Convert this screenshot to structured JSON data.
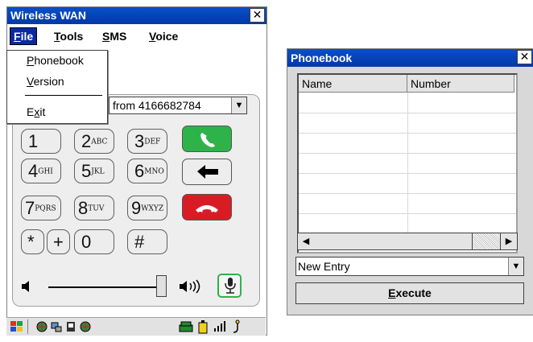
{
  "wireless_window": {
    "title": "Wireless WAN",
    "close_label": "✕",
    "menu": {
      "file_pre": "",
      "file_u": "F",
      "file_post": "ile",
      "tools_u": "T",
      "tools_post": "ools",
      "sms_u": "S",
      "sms_post": "MS",
      "voice_u": "V",
      "voice_post": "oice"
    },
    "file_menu": {
      "phonebook_u": "P",
      "phonebook_post": "honebook",
      "version_u": "V",
      "version_post": "ersion",
      "exit_pre": "E",
      "exit_u": "x",
      "exit_post": "it"
    },
    "caller_dropdown": {
      "value": "from 4166682784"
    },
    "keypad": [
      {
        "main": "1",
        "sub": ""
      },
      {
        "main": "2",
        "sub": "ABC"
      },
      {
        "main": "3",
        "sub": "DEF"
      },
      {
        "main": "4",
        "sub": "GHI"
      },
      {
        "main": "5",
        "sub": "JKL"
      },
      {
        "main": "6",
        "sub": "MNO"
      },
      {
        "main": "7",
        "sub": "PQRS"
      },
      {
        "main": "8",
        "sub": "TUV"
      },
      {
        "main": "9",
        "sub": "WXYZ"
      },
      {
        "main": "*",
        "sub": ""
      },
      {
        "main": "+",
        "sub": ""
      },
      {
        "main": "0",
        "sub": ""
      },
      {
        "main": "#",
        "sub": ""
      }
    ],
    "volume_level": 0.97,
    "colors": {
      "call": "#2db34a",
      "end": "#d91c24",
      "title": "#0a4fc8",
      "menu_active": "#0a2aa0"
    }
  },
  "phonebook_window": {
    "title": "Phonebook",
    "close_label": "✕",
    "columns": [
      "Name",
      "Number"
    ],
    "entry_select": {
      "value": "New Entry"
    },
    "execute_pre": "",
    "execute_u": "E",
    "execute_post": "xecute"
  }
}
